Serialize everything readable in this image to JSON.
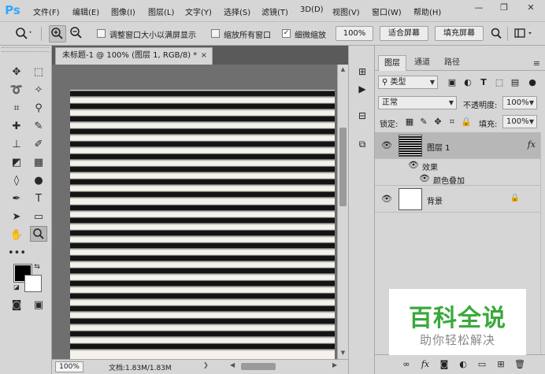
{
  "app": {
    "logo": "Ps",
    "menu": [
      "文件(F)",
      "编辑(E)",
      "图像(I)",
      "图层(L)",
      "文字(Y)",
      "选择(S)",
      "滤镜(T)",
      "3D(D)",
      "视图(V)",
      "窗口(W)",
      "帮助(H)"
    ],
    "window_controls": [
      "—",
      "❐",
      "✕"
    ]
  },
  "options": {
    "resize_windows_label": "调整窗口大小以满屏显示",
    "resize_windows_checked": false,
    "zoom_all_windows_label": "缩放所有窗口",
    "zoom_all_windows_checked": false,
    "scrubby_zoom_label": "细微缩放",
    "scrubby_zoom_checked": true,
    "zoom_value": "100%",
    "fit_screen_label": "适合屏幕",
    "fill_screen_label": "填充屏幕"
  },
  "document": {
    "tab_title": "未标题-1 @ 100% (图层 1, RGB/8) *",
    "tab_close": "×",
    "zoom": "100%",
    "doc_info": "文档:1.83M/1.83M",
    "stripe_count": 21
  },
  "panel": {
    "tabs": [
      "图层",
      "通道",
      "路径"
    ],
    "filter_kind": "类型",
    "blend_mode": "正常",
    "opacity_label": "不透明度:",
    "opacity_value": "100%",
    "lock_label": "锁定:",
    "fill_label": "填充:",
    "fill_value": "100%",
    "layers": [
      {
        "name": "图层 1",
        "fx": "fx",
        "selected": true
      },
      {
        "name": "背景",
        "locked": true,
        "selected": false
      }
    ],
    "effects_label": "效果",
    "effect_item": "颜色叠加"
  },
  "watermark": {
    "title": "百科全说",
    "subtitle": "助你轻松解决"
  },
  "colors": {
    "accent_blue": "#31a8ff",
    "watermark_green": "#3aa93c",
    "ui_gray": "#d6d6d6",
    "workspace_gray": "#6f6f6f"
  },
  "icons": {
    "fit_screen_hint": "search-icon"
  }
}
